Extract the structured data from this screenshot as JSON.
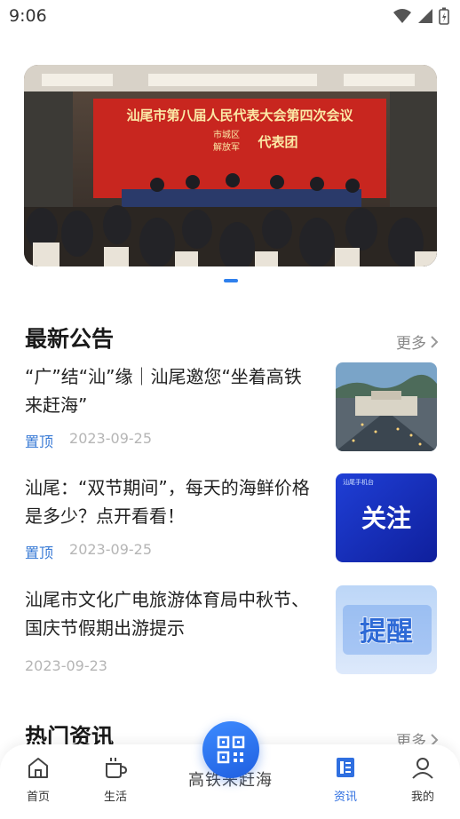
{
  "status": {
    "time": "9:06"
  },
  "banner": {
    "headline": "汕尾市第八届人民代表大会第四次会议",
    "sub_left_1": "市城区",
    "sub_left_2": "解放军",
    "sub_right": "代表团"
  },
  "announcements": {
    "title": "最新公告",
    "more_label": "更多",
    "items": [
      {
        "title": "“广”结“汕”缘｜汕尾邀您“坐着高铁来赶海”",
        "pin": "置顶",
        "date": "2023-09-25"
      },
      {
        "title": "汕尾：“双节期间”，每天的海鲜价格是多少？点开看看！",
        "pin": "置顶",
        "date": "2023-09-25",
        "thumb_text": "关注",
        "thumb_small": "汕尾手机台"
      },
      {
        "title": "汕尾市文化广电旅游体育局中秋节、国庆节假期出游提示",
        "pin": "",
        "date": "2023-09-23",
        "thumb_text": "提醒"
      }
    ]
  },
  "hot_news": {
    "title": "热门资讯",
    "more_label": "更多"
  },
  "bottom_nav": {
    "items": [
      {
        "label": "首页",
        "icon": "home-icon"
      },
      {
        "label": "生活",
        "icon": "cup-icon"
      },
      {
        "label": "资讯",
        "icon": "news-icon",
        "active": true
      },
      {
        "label": "我的",
        "icon": "user-icon"
      }
    ],
    "center_text": "高铁来赶海",
    "scan_icon": "qr-code-icon"
  },
  "colors": {
    "accent": "#2f6fe0",
    "pin": "#3a7bd5",
    "date": "#b5b5b5"
  }
}
